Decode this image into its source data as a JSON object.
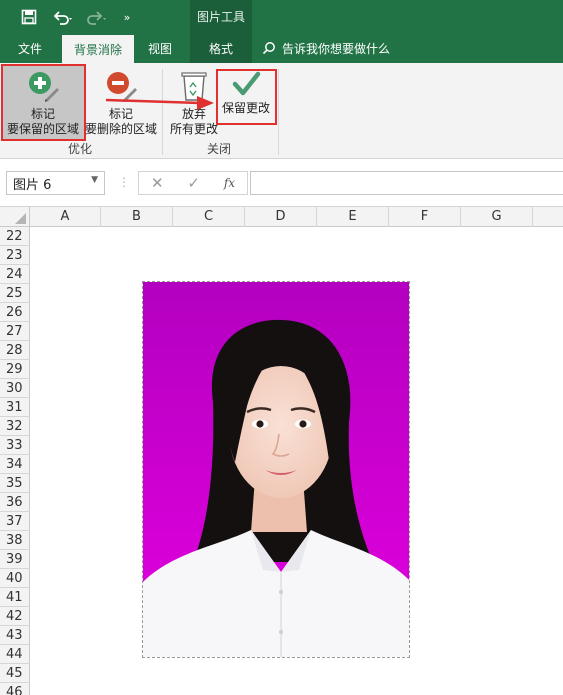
{
  "context_tab_group": "图片工具",
  "qat": {
    "save_icon": "save-icon",
    "undo_icon": "undo-icon",
    "redo_icon": "redo-icon",
    "more_icon": "more-icon"
  },
  "tabs": [
    {
      "label": "文件"
    },
    {
      "label": "背景消除"
    },
    {
      "label": "视图"
    },
    {
      "label": "格式"
    }
  ],
  "tell_me": "告诉我你想要做什么",
  "ribbon": {
    "mark_keep": {
      "line1": "标记",
      "line2": "要保留的区域"
    },
    "mark_remove": {
      "line1": "标记",
      "line2": "要删除的区域"
    },
    "discard": {
      "line1": "放弃",
      "line2": "所有更改"
    },
    "keep_changes": {
      "label": "保留更改"
    },
    "group_refine": "优化",
    "group_close": "关闭"
  },
  "formula_bar": {
    "name_box": "图片 6",
    "fx": "fx",
    "formula": ""
  },
  "columns": [
    "A",
    "B",
    "C",
    "D",
    "E",
    "F",
    "G"
  ],
  "rows": [
    "22",
    "23",
    "24",
    "25",
    "26",
    "27",
    "28",
    "29",
    "30",
    "31",
    "32",
    "33",
    "34",
    "35",
    "36",
    "37",
    "38",
    "39",
    "40",
    "41",
    "42",
    "43",
    "44",
    "45",
    "46"
  ],
  "colors": {
    "brand": "#217346",
    "photo_bg": "#c800cc",
    "highlight": "#e03030"
  }
}
